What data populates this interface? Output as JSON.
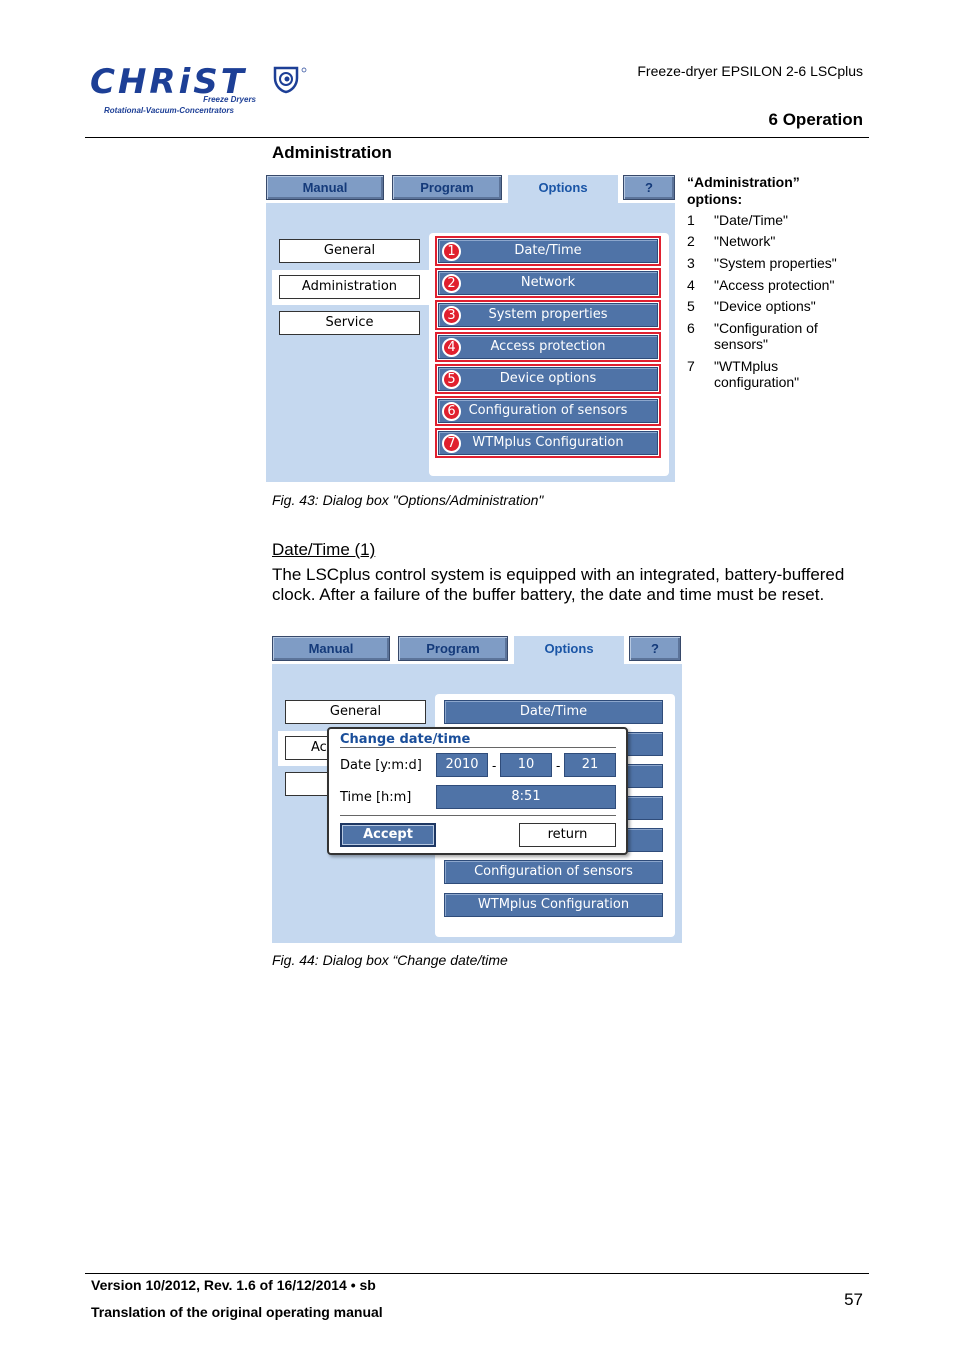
{
  "header": {
    "logo_text": "CHRiST",
    "logo_tagline_1": "Freeze Dryers",
    "logo_tagline_2": "Rotational-Vacuum-Concentrators",
    "product": "Freeze-dryer EPSILON 2-6 LSCplus",
    "section": "6 Operation"
  },
  "admin_heading": "Administration",
  "fig43": {
    "tabs": [
      "Manual",
      "Program",
      "Options",
      "?"
    ],
    "side_buttons": [
      "General",
      "Administration",
      "Service"
    ],
    "options": [
      {
        "n": "1",
        "label": "Date/Time"
      },
      {
        "n": "2",
        "label": "Network"
      },
      {
        "n": "3",
        "label": "System properties"
      },
      {
        "n": "4",
        "label": "Access protection"
      },
      {
        "n": "5",
        "label": "Device options"
      },
      {
        "n": "6",
        "label": "Configuration of sensors"
      },
      {
        "n": "7",
        "label": "WTMplus Configuration"
      }
    ],
    "caption": "Fig. 43: Dialog box \"Options/Administration\""
  },
  "options_list": {
    "title": "“Administration” options:",
    "items": [
      {
        "n": "1",
        "text": "\"Date/Time\""
      },
      {
        "n": "2",
        "text": "\"Network\""
      },
      {
        "n": "3",
        "text": "\"System properties\""
      },
      {
        "n": "4",
        "text": "\"Access protection\""
      },
      {
        "n": "5",
        "text": "\"Device options\""
      },
      {
        "n": "6",
        "text": "\"Configuration of sensors\""
      },
      {
        "n": "7",
        "text": "\"WTMplus configuration\""
      }
    ]
  },
  "datetime_section": {
    "heading": "Date/Time (1)",
    "paragraph": "The LSCplus control system is equipped with an integrated, battery-buffered clock. After a failure of the buffer battery, the date and time must be reset."
  },
  "fig44": {
    "tabs": [
      "Manual",
      "Program",
      "Options",
      "?"
    ],
    "side_general": "General",
    "side_admin_partial": "Ac",
    "options_visible": [
      "Date/Time",
      "Configuration of sensors",
      "WTMplus Configuration"
    ],
    "dialog": {
      "title": "Change date/time",
      "date_label": "Date [y:m:d]",
      "year": "2010",
      "month": "10",
      "day": "21",
      "time_label": "Time [h:m]",
      "time": "8:51",
      "accept": "Accept",
      "return": "return"
    },
    "caption": "Fig. 44: Dialog box “Change date/time"
  },
  "footer": {
    "version": "Version 10/2012, Rev. 1.6 of 16/12/2014 • sb",
    "translation": "Translation of the original operating manual",
    "page": "57"
  }
}
